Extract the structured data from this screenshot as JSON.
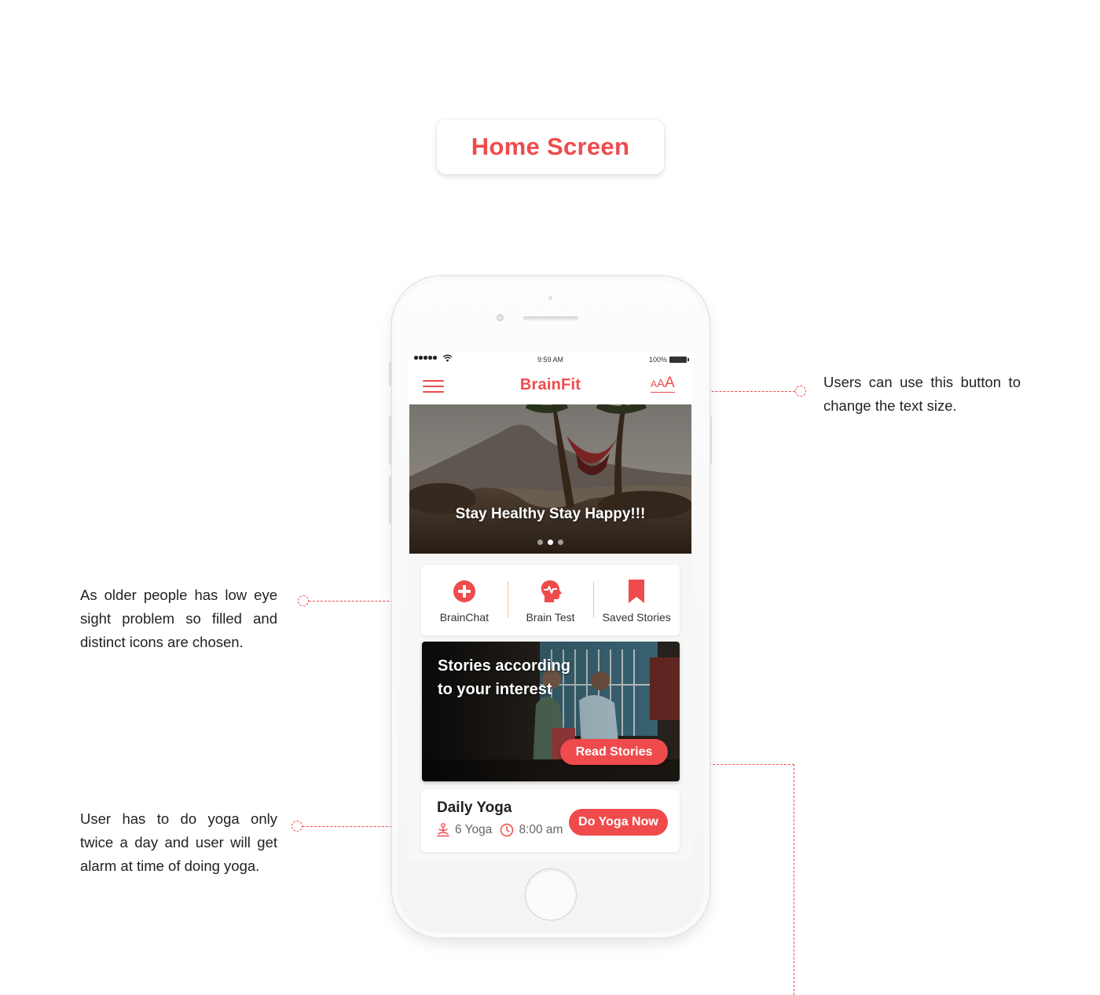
{
  "header": {
    "title": "Home Screen"
  },
  "annotations": {
    "text_size_note": "Users can use this button to change the text size.",
    "icons_note": "As older people has low eye sight problem so filled and distinct icons are chosen.",
    "yoga_note": "User has to do yoga only twice a day and user will get alarm at time of doing yoga."
  },
  "statusbar": {
    "time": "9:59 AM",
    "battery": "100%"
  },
  "appbar": {
    "title": "BrainFit",
    "menu_icon": "hamburger-menu-icon",
    "text_size": {
      "small": "A",
      "medium": "A",
      "large": "A"
    }
  },
  "hero": {
    "caption": "Stay Healthy Stay Happy!!!",
    "slides": 3,
    "active_slide": 2
  },
  "quick_actions": [
    {
      "label": "BrainChat",
      "icon": "plus-circle-icon"
    },
    {
      "label": "Brain Test",
      "icon": "brain-head-icon"
    },
    {
      "label": "Saved Stories",
      "icon": "bookmark-icon"
    }
  ],
  "stories": {
    "title_line1": "Stories according",
    "title_line2": "to your interest",
    "button": "Read Stories"
  },
  "yoga": {
    "title": "Daily Yoga",
    "count": "6 Yoga",
    "time": "8:00 am",
    "button": "Do Yoga Now"
  },
  "colors": {
    "accent": "#ef4b4c",
    "divider": "#f1c6a0",
    "text": "#222222"
  }
}
